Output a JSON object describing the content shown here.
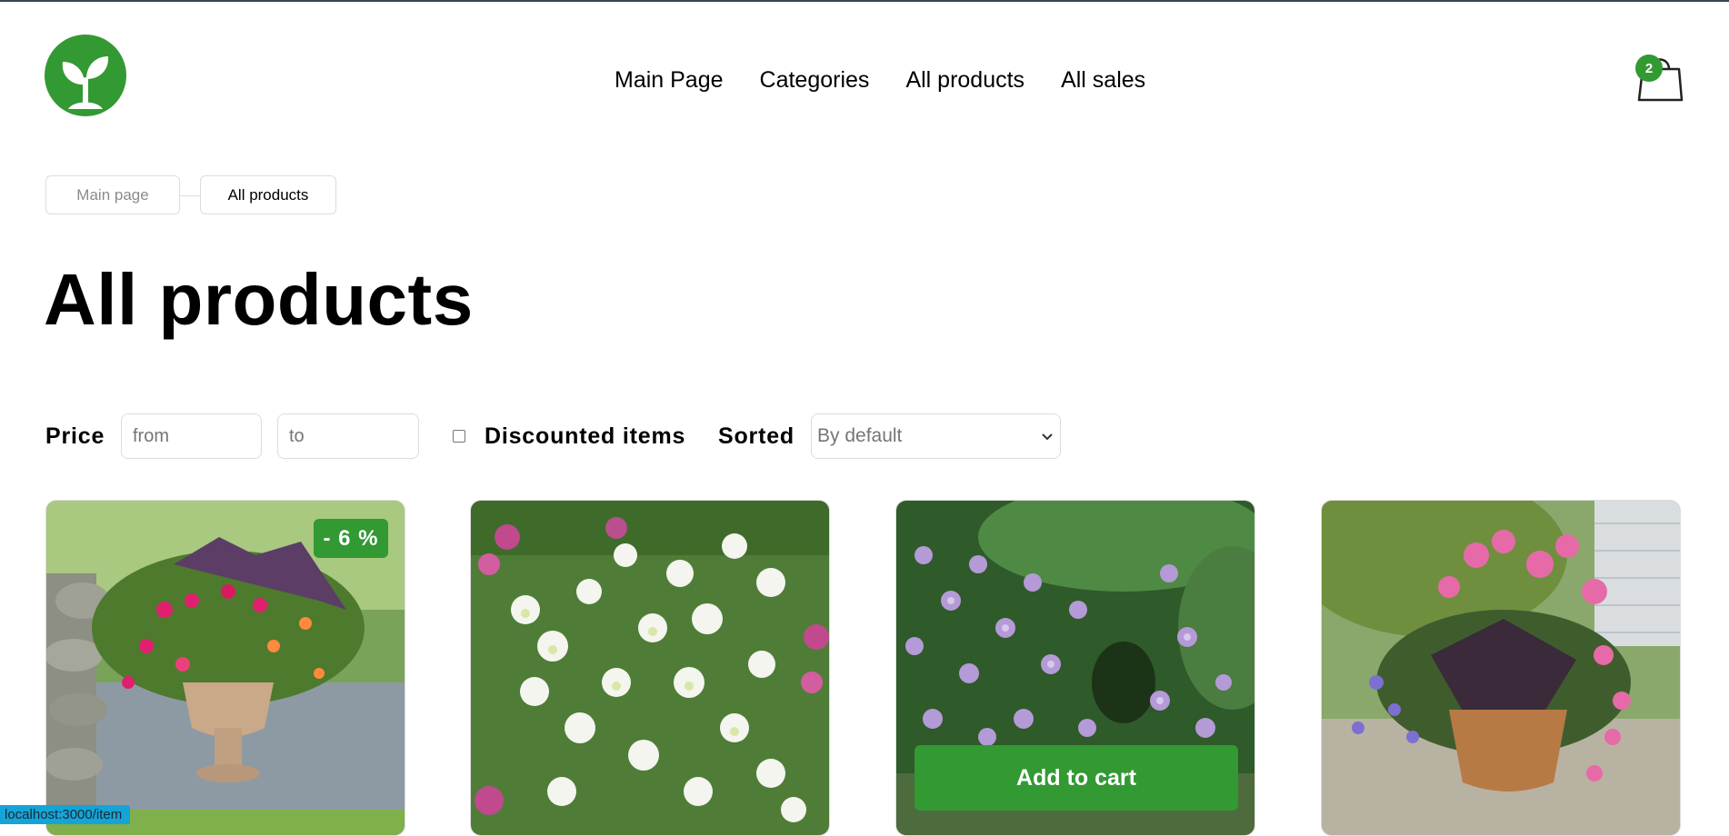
{
  "header": {
    "nav": [
      "Main Page",
      "Categories",
      "All products",
      "All sales"
    ],
    "cart_count": "2",
    "logo_icon": "sprout-icon",
    "cart_icon": "shopping-bag-icon"
  },
  "breadcrumb": [
    "Main page",
    "All products"
  ],
  "page": {
    "title": "All products"
  },
  "filters": {
    "price_label": "Price",
    "from_placeholder": "from",
    "to_placeholder": "to",
    "discount_label": "Discounted items",
    "discount_checked": false,
    "sort_label": "Sorted",
    "sort_value": "By default"
  },
  "products": [
    {
      "discount_badge": "- 6 %"
    },
    {},
    {
      "add_to_cart": "Add to cart"
    },
    {}
  ],
  "status_bar": {
    "url": "localhost:3000/item"
  },
  "colors": {
    "accent": "#339933",
    "border": "#dddddd",
    "muted_text": "#8b8b8b"
  }
}
